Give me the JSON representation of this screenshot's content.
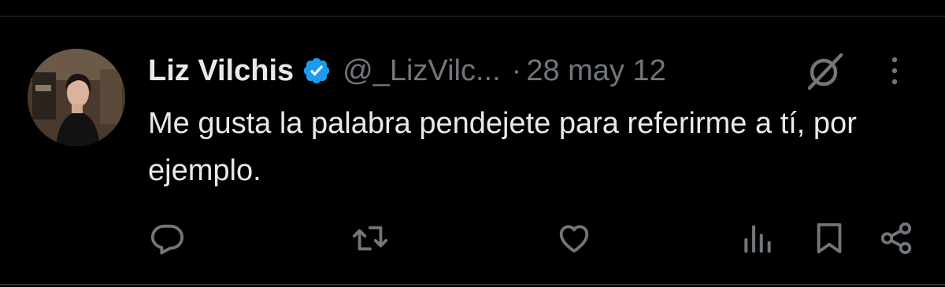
{
  "tweet": {
    "author_name": "Liz Vilchis",
    "handle": "@_LizVilc...",
    "separator": "·",
    "date": "28 may 12",
    "text": "Me gusta la palabra pendejete para referirme a tí, por ejemplo.",
    "verified": true
  },
  "icons": {
    "verified": "verified-badge-icon",
    "grok": "grok-icon",
    "more": "more-vertical-icon",
    "reply": "reply-icon",
    "retweet": "retweet-icon",
    "like": "heart-icon",
    "views": "views-icon",
    "bookmark": "bookmark-icon",
    "share": "share-icon"
  },
  "colors": {
    "background": "#000000",
    "text_primary": "#e7e9ea",
    "text_secondary": "#71767b",
    "verified_blue": "#1d9bf0",
    "divider": "#2f3336"
  }
}
